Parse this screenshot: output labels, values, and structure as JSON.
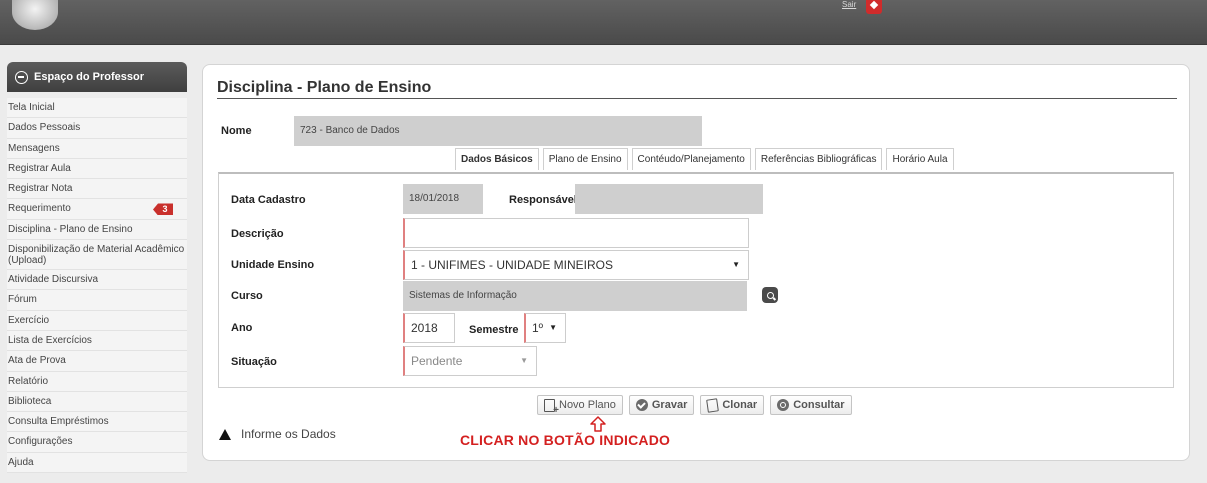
{
  "topbar": {
    "link_text": "Sair"
  },
  "sidebar": {
    "title": "Espaço do Professor",
    "items": [
      {
        "label": "Tela Inicial"
      },
      {
        "label": "Dados Pessoais"
      },
      {
        "label": "Mensagens"
      },
      {
        "label": "Registrar Aula"
      },
      {
        "label": "Registrar Nota"
      },
      {
        "label": "Requerimento",
        "badge": "3"
      },
      {
        "label": "Disciplina - Plano de Ensino"
      },
      {
        "label": "Disponibilização de Material Acadêmico (Upload)"
      },
      {
        "label": "Atividade Discursiva"
      },
      {
        "label": "Fórum"
      },
      {
        "label": "Exercício"
      },
      {
        "label": "Lista de Exercícios"
      },
      {
        "label": "Ata de Prova"
      },
      {
        "label": "Relatório"
      },
      {
        "label": "Biblioteca"
      },
      {
        "label": "Consulta Empréstimos"
      },
      {
        "label": "Configurações"
      },
      {
        "label": "Ajuda"
      }
    ]
  },
  "main": {
    "title": "Disciplina - Plano de Ensino",
    "nome_label": "Nome",
    "nome_value": "723 - Banco de Dados",
    "tabs": [
      {
        "label": "Dados Básicos"
      },
      {
        "label": "Plano de Ensino"
      },
      {
        "label": "Contéudo/Planejamento"
      },
      {
        "label": "Referências Bibliográficas"
      },
      {
        "label": "Horário Aula"
      }
    ],
    "form": {
      "data_cadastro_label": "Data Cadastro",
      "data_cadastro_value": "18/01/2018",
      "responsavel_label": "Responsável",
      "responsavel_value": "",
      "descricao_label": "Descrição",
      "descricao_value": "",
      "unidade_label": "Unidade Ensino",
      "unidade_value": "1 - UNIFIMES - UNIDADE MINEIROS",
      "curso_label": "Curso",
      "curso_value": "Sistemas de Informação",
      "ano_label": "Ano",
      "ano_value": "2018",
      "semestre_label": "Semestre",
      "semestre_value": "1º",
      "situacao_label": "Situação",
      "situacao_value": "Pendente"
    },
    "buttons": {
      "novo": "Novo Plano",
      "gravar": "Gravar",
      "clonar": "Clonar",
      "consultar": "Consultar"
    },
    "status_message": "Informe os Dados",
    "instruction": "CLICAR NO BOTÃO INDICADO"
  },
  "colors": {
    "instruction": "#d42020",
    "badge": "#c9302c",
    "topbar": "#4f4f4f"
  }
}
